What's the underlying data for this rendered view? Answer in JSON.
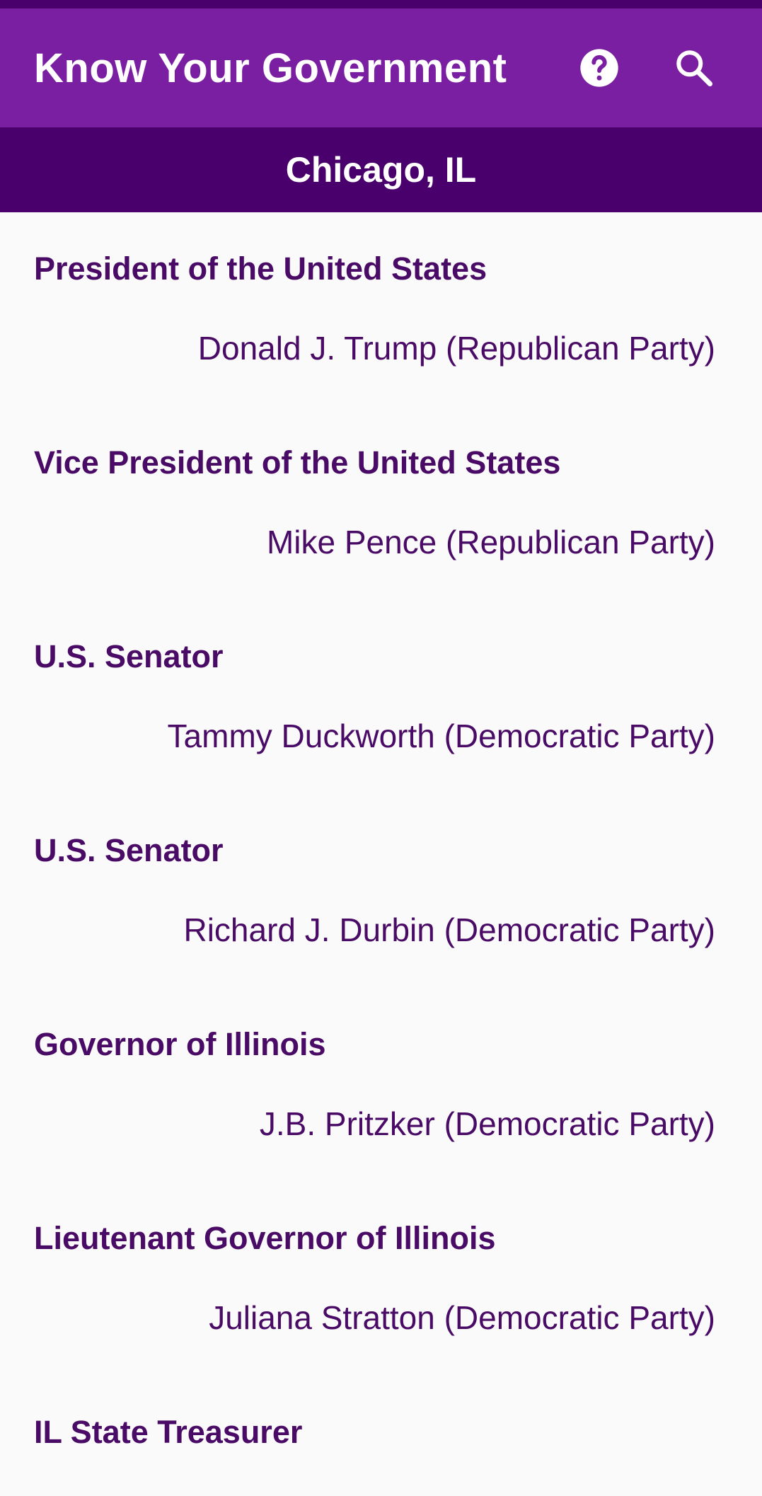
{
  "app_bar": {
    "title": "Know Your Government",
    "help_icon": "help-circle-icon",
    "search_icon": "search-icon"
  },
  "location": {
    "label": "Chicago, IL"
  },
  "colors": {
    "primary": "#7b1fa2",
    "primary_dark": "#4a006c",
    "text": "#4a0b66",
    "background": "#fafafa"
  },
  "offices": [
    {
      "title": "President of the United States",
      "official": "Donald J. Trump (Republican Party)"
    },
    {
      "title": "Vice President of the United States",
      "official": "Mike Pence (Republican Party)"
    },
    {
      "title": "U.S. Senator",
      "official": "Tammy Duckworth (Democratic Party)"
    },
    {
      "title": "U.S. Senator",
      "official": "Richard J. Durbin (Democratic Party)"
    },
    {
      "title": "Governor of Illinois",
      "official": "J.B. Pritzker (Democratic Party)"
    },
    {
      "title": "Lieutenant Governor of Illinois",
      "official": "Juliana Stratton (Democratic Party)"
    },
    {
      "title": "IL State Treasurer",
      "official": ""
    }
  ]
}
